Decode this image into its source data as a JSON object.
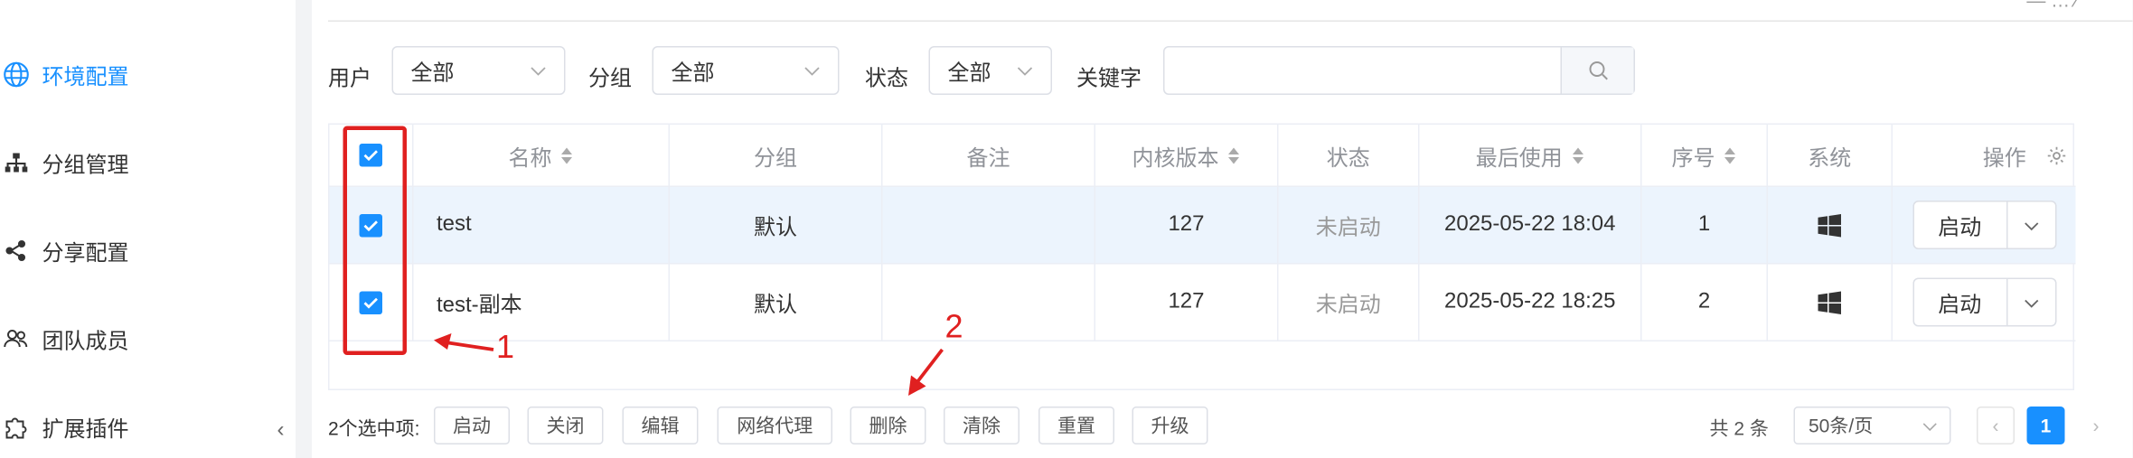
{
  "sidebar": {
    "items": [
      {
        "label": "环境配置",
        "icon": "globe-icon",
        "active": true
      },
      {
        "label": "分组管理",
        "icon": "org-tree-icon",
        "active": false
      },
      {
        "label": "分享配置",
        "icon": "share-icon",
        "active": false
      },
      {
        "label": "团队成员",
        "icon": "team-icon",
        "active": false
      },
      {
        "label": "扩展插件",
        "icon": "puzzle-icon",
        "active": false
      }
    ],
    "collapse_glyph": "‹"
  },
  "filters": {
    "user_label": "用户",
    "user_value": "全部",
    "group_label": "分组",
    "group_value": "全部",
    "status_label": "状态",
    "status_value": "全部",
    "keyword_label": "关键字",
    "keyword_placeholder": ""
  },
  "table": {
    "headers": {
      "name": "名称",
      "group": "分组",
      "note": "备注",
      "kernel": "内核版本",
      "status": "状态",
      "last_used": "最后使用",
      "seq": "序号",
      "system": "系统",
      "ops": "操作"
    },
    "rows": [
      {
        "name": "test",
        "group": "默认",
        "note": "",
        "kernel": "127",
        "status": "未启动",
        "last_used": "2025-05-22 18:04",
        "seq": "1",
        "system_icon": "windows-icon",
        "action": "启动"
      },
      {
        "name": "test-副本",
        "group": "默认",
        "note": "",
        "kernel": "127",
        "status": "未启动",
        "last_used": "2025-05-22 18:25",
        "seq": "2",
        "system_icon": "windows-icon",
        "action": "启动"
      }
    ]
  },
  "bottom": {
    "selected_label": "2个选中项:",
    "buttons": [
      "启动",
      "关闭",
      "编辑",
      "网络代理",
      "删除",
      "清除",
      "重置",
      "升级"
    ],
    "total": "共 2 条",
    "page_size": "50条/页",
    "prev": "‹",
    "current_page": "1",
    "next": "›"
  },
  "annotations": {
    "label1": "1",
    "label2": "2",
    "color": "#e02020"
  },
  "colors": {
    "accent": "#1890ff",
    "row_highlight": "#ecf4fd",
    "annotation": "#e02020"
  },
  "top_fragment": "—  …  ∕"
}
